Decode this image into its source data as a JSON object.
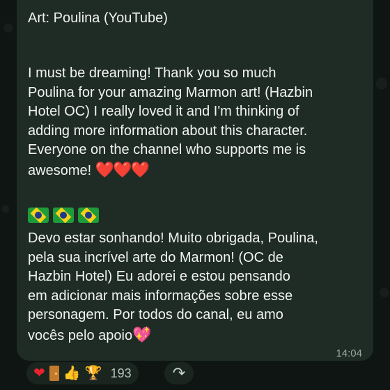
{
  "top_strip_colors": [
    "#1f2c25",
    "#3a3a3a",
    "#2b3a30",
    "#4b2b2b",
    "#2e3d33",
    "#1f2c25"
  ],
  "message": {
    "credit": "Art: Poulina (YouTube)",
    "english": "I must be dreaming! Thank you so much\nPoulina for your amazing Marmon art! (Hazbin\nHotel OC) I really loved it and I'm thinking of\nadding more information about this character.\nEveryone on the channel who supports me is\nawesome! ",
    "english_emoji": "❤️❤️❤️",
    "flags_emoji": "🇧🇷🇧🇷🇧🇷",
    "portuguese": "Devo estar sonhando! Muito obrigada, Poulina,\npela sua incrível arte do Marmon! (OC de\nHazbin Hotel) Eu adorei e estou pensando\nem adicionar mais informações sobre esse\npersonagem. Por todos do canal, eu amo\nvocês pelo apoio",
    "portuguese_emoji": "💖",
    "time": "14:04"
  },
  "reactions": {
    "items": [
      {
        "icon": "red-heart-icon",
        "glyph": "❤"
      },
      {
        "icon": "door-icon",
        "glyph": ""
      },
      {
        "icon": "thumbs-up-icon",
        "glyph": "👍"
      },
      {
        "icon": "trophy-icon",
        "glyph": "🏆"
      }
    ],
    "count": "193"
  },
  "share": {
    "icon": "share-arrow-icon",
    "glyph": "↷"
  }
}
